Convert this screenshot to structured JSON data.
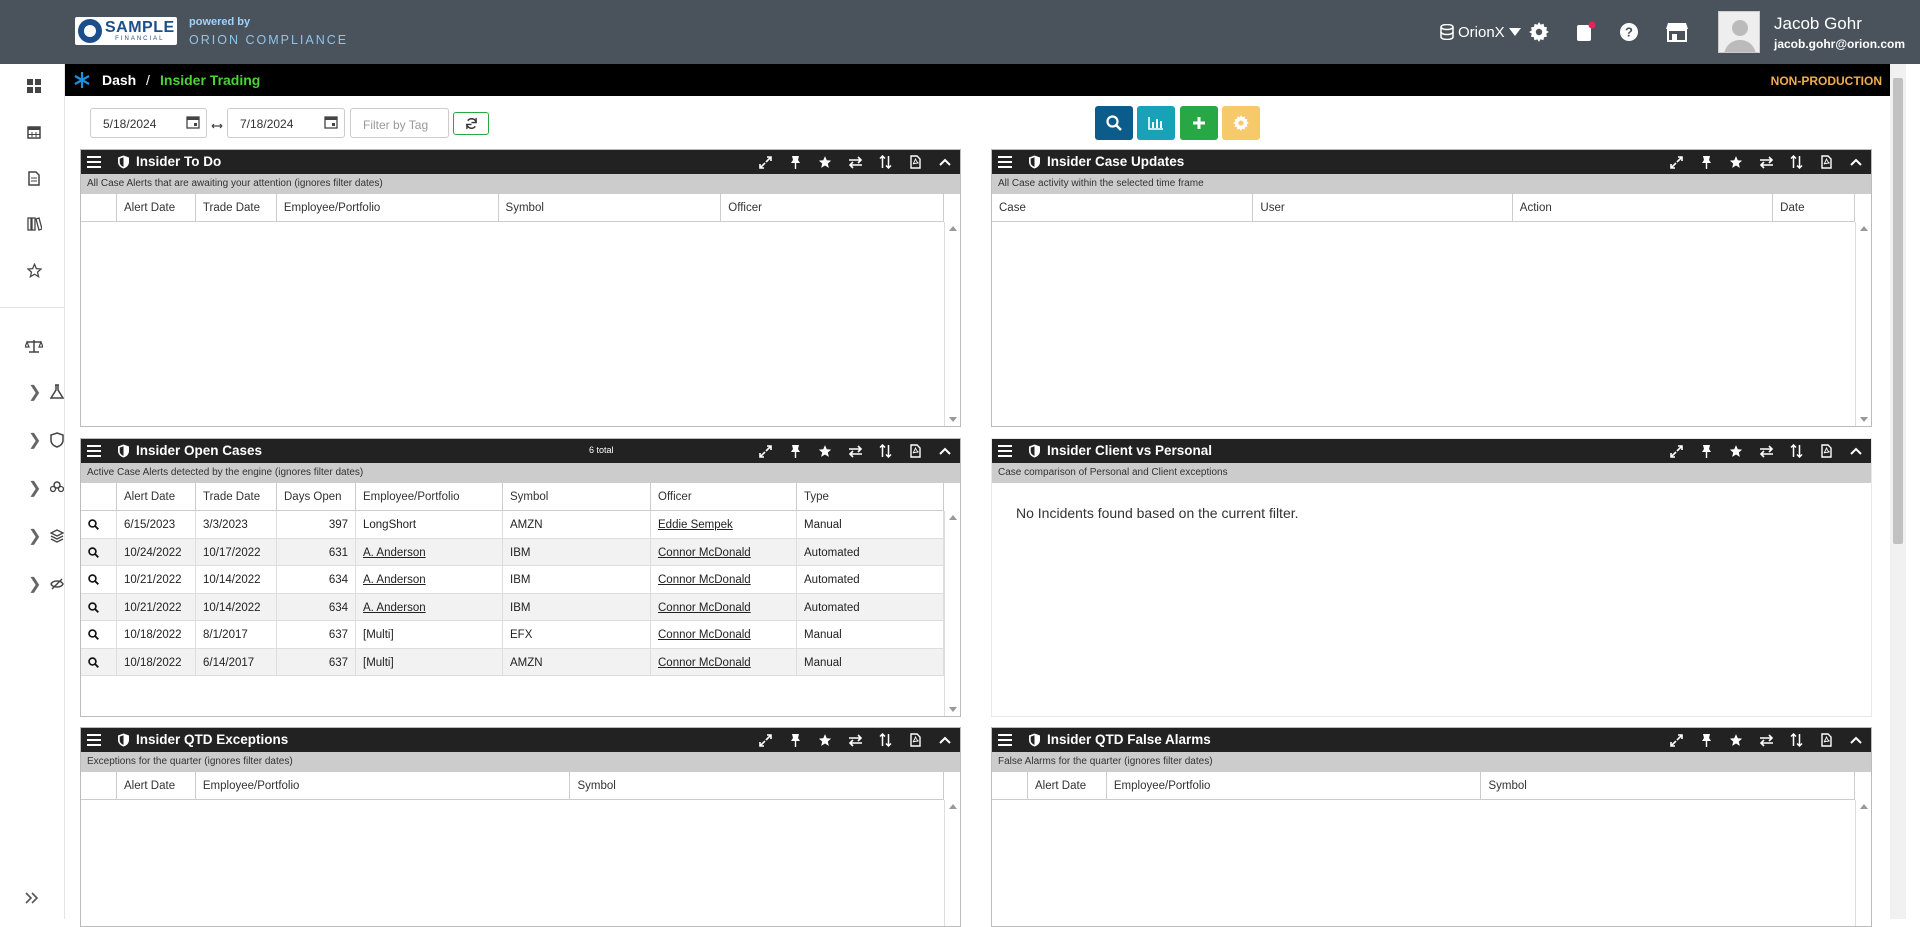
{
  "brand": {
    "logo_line1": "SAMPLE",
    "logo_line2": "FINANCIAL",
    "powered_by": "powered by",
    "product": "ORION COMPLIANCE"
  },
  "topbar": {
    "database": "OrionX",
    "user_name": "Jacob Gohr",
    "user_email": "jacob.gohr@orion.com"
  },
  "breadcrumb": {
    "home": "Dash",
    "separator": "/",
    "current": "Insider Trading",
    "environment": "NON-PRODUCTION"
  },
  "filters": {
    "start_date": "5/18/2024",
    "end_date": "7/18/2024",
    "tag_placeholder": "Filter by Tag"
  },
  "colors": {
    "accent_green": "#4cd137",
    "search_btn": "#0b5c8a",
    "chart_btn": "#17a2b8",
    "add_btn": "#28a745",
    "settings_btn": "#f6c96a",
    "environment": "#f0ad4e"
  },
  "panels": {
    "todo": {
      "title": "Insider To Do",
      "subtitle": "All Case Alerts that are awaiting your attention (ignores filter dates)",
      "columns": [
        "Alert Date",
        "Trade Date",
        "Employee/Portfolio",
        "Symbol",
        "Officer"
      ]
    },
    "updates": {
      "title": "Insider Case Updates",
      "subtitle": "All Case activity within the selected time frame",
      "columns": [
        "Case",
        "User",
        "Action",
        "Date"
      ]
    },
    "open": {
      "title": "Insider Open Cases",
      "total": "6 total",
      "subtitle": "Active Case Alerts detected by the engine (ignores filter dates)",
      "columns": [
        "Alert Date",
        "Trade Date",
        "Days Open",
        "Employee/Portfolio",
        "Symbol",
        "Officer",
        "Type"
      ],
      "rows": [
        {
          "alert": "6/15/2023",
          "trade": "3/3/2023",
          "days": "397",
          "emp": "LongShort",
          "emp_link": false,
          "symbol": "AMZN",
          "officer": "Eddie Sempek",
          "type": "Manual"
        },
        {
          "alert": "10/24/2022",
          "trade": "10/17/2022",
          "days": "631",
          "emp": "A. Anderson",
          "emp_link": true,
          "symbol": "IBM",
          "officer": "Connor McDonald",
          "type": "Automated"
        },
        {
          "alert": "10/21/2022",
          "trade": "10/14/2022",
          "days": "634",
          "emp": "A. Anderson",
          "emp_link": true,
          "symbol": "IBM",
          "officer": "Connor McDonald",
          "type": "Automated"
        },
        {
          "alert": "10/21/2022",
          "trade": "10/14/2022",
          "days": "634",
          "emp": "A. Anderson",
          "emp_link": true,
          "symbol": "IBM",
          "officer": "Connor McDonald",
          "type": "Automated"
        },
        {
          "alert": "10/18/2022",
          "trade": "8/1/2017",
          "days": "637",
          "emp": "[Multi]",
          "emp_link": false,
          "symbol": "EFX",
          "officer": "Connor McDonald",
          "type": "Manual"
        },
        {
          "alert": "10/18/2022",
          "trade": "6/14/2017",
          "days": "637",
          "emp": "[Multi]",
          "emp_link": false,
          "symbol": "AMZN",
          "officer": "Connor McDonald",
          "type": "Manual"
        }
      ]
    },
    "client": {
      "title": "Insider Client vs Personal",
      "subtitle": "Case comparison of Personal and Client exceptions",
      "empty": "No Incidents found based on the current filter."
    },
    "qtd_exc": {
      "title": "Insider QTD Exceptions",
      "subtitle": "Exceptions for the quarter (ignores filter dates)",
      "columns": [
        "Alert Date",
        "Employee/Portfolio",
        "Symbol"
      ]
    },
    "qtd_fa": {
      "title": "Insider QTD False Alarms",
      "subtitle": "False Alarms for the quarter (ignores filter dates)",
      "columns": [
        "Alert Date",
        "Employee/Portfolio",
        "Symbol"
      ]
    }
  }
}
